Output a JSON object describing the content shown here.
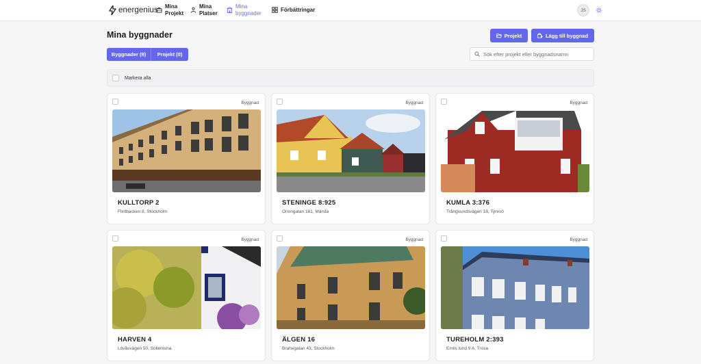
{
  "app": {
    "name": "energenius"
  },
  "nav": [
    {
      "label_line1": "Mina",
      "label_line2": "Projekt",
      "icon": "briefcase-icon",
      "active": false
    },
    {
      "label_line1": "Mina",
      "label_line2": "Platser",
      "icon": "person-icon",
      "active": false
    },
    {
      "label_line1": "Mina",
      "label_line2": "byggnader",
      "icon": "building-icon",
      "active": true
    },
    {
      "label": "Förbättringar",
      "icon": "grid-icon",
      "active": false
    }
  ],
  "user": {
    "initials": "JS"
  },
  "page": {
    "title": "Mina byggnader"
  },
  "actions": {
    "project_button": "Projekt",
    "add_building_button": "Lägg till byggnad"
  },
  "tabs": {
    "buildings": "Byggnader (9)",
    "projects": "Projekt (0)"
  },
  "search": {
    "placeholder": "Sök efter projekt eller byggnadsnamn",
    "value": ""
  },
  "select_all": {
    "label": "Markera alla"
  },
  "cards": [
    {
      "type_label": "Byggnad",
      "name": "KULLTORP 2",
      "address": "Flintbacken 8, Stockholm"
    },
    {
      "type_label": "Byggnad",
      "name": "STENINGE 8:925",
      "address": "Oriongatan 161, Märsta"
    },
    {
      "type_label": "Byggnad",
      "name": "KUMLA 3:376",
      "address": "Trångsundsvägen 18, Tyresö"
    },
    {
      "type_label": "Byggnad",
      "name": "HARVEN 4",
      "address": "Lövåsvägen 50, Sollentuna"
    },
    {
      "type_label": "Byggnad",
      "name": "ÄLGEN 16",
      "address": "Brahegatan 43, Stockholm"
    },
    {
      "type_label": "Byggnad",
      "name": "TUREHOLM 2:393",
      "address": "Emils lund 9 A, Trosa"
    }
  ],
  "colors": {
    "accent": "#6466ec",
    "active_nav": "#6c6cf0",
    "background": "#f6f6f7"
  }
}
